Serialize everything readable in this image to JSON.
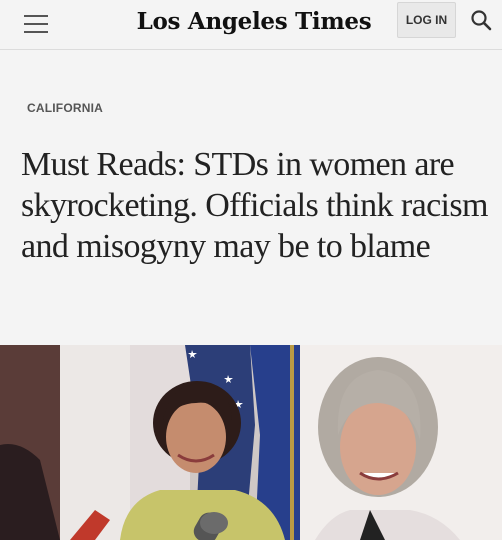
{
  "header": {
    "menu_icon": "hamburger-menu-icon",
    "masthead": "Los Angeles Times",
    "login_label": "LOG IN",
    "search_icon": "search-icon"
  },
  "article": {
    "section": "CALIFORNIA",
    "headline": "Must Reads: STDs in women are skyrocketing. Officials think racism and misogyny may be to blame"
  },
  "photo": {
    "image": "photo of two women at a press conference with flags behind them"
  },
  "colors": {
    "background": "#f4f4f4",
    "headline_text": "#222222",
    "kicker_text": "#555555"
  }
}
